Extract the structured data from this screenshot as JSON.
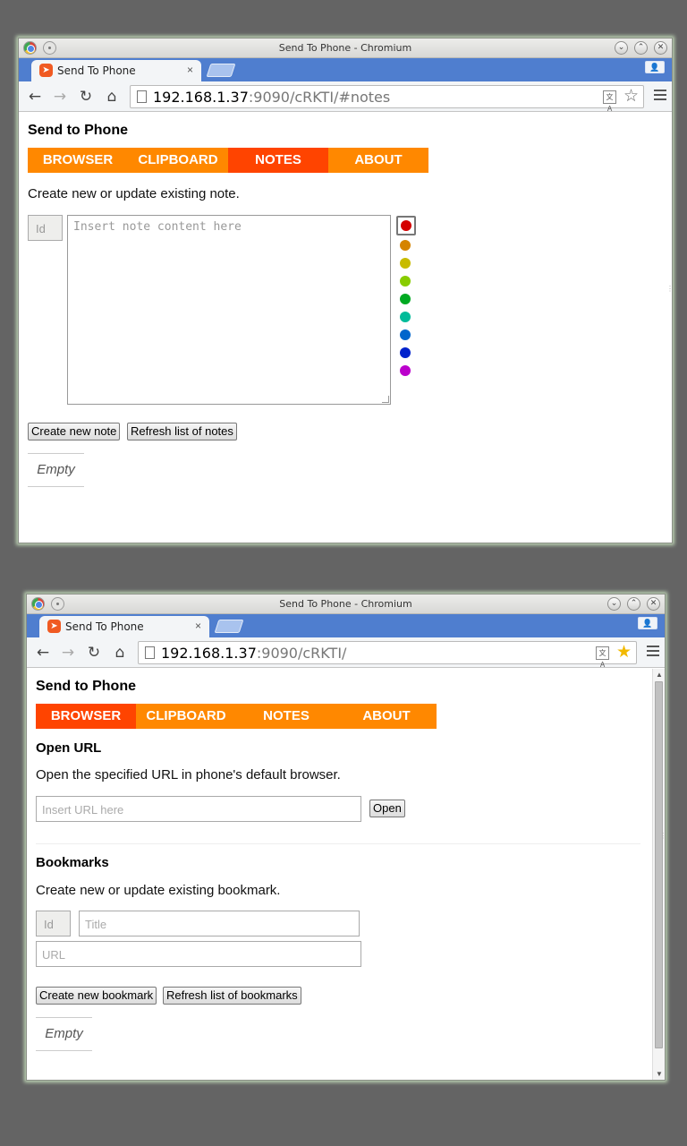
{
  "window1": {
    "title": "Send To Phone - Chromium",
    "tab_label": "Send To Phone",
    "tab_close": "×",
    "url_host": "192.168.1.37",
    "url_rest": ":9090/cRKTI/#notes",
    "app_title": "Send to Phone",
    "nav": [
      "BROWSER",
      "CLIPBOARD",
      "NOTES",
      "ABOUT"
    ],
    "active_nav": "NOTES",
    "intro": "Create new or update existing note.",
    "id_placeholder": "Id",
    "note_placeholder": "Insert note content here",
    "colors": [
      "#d40000",
      "#d58400",
      "#c8bb00",
      "#88cc00",
      "#00aa22",
      "#00bb99",
      "#0066cc",
      "#0022cc",
      "#bb00cc"
    ],
    "selected_color": "#d40000",
    "create_button": "Create new note",
    "refresh_button": "Refresh list of notes",
    "empty_label": "Empty"
  },
  "window2": {
    "title": "Send To Phone - Chromium",
    "tab_label": "Send To Phone",
    "tab_close": "×",
    "url_host": "192.168.1.37",
    "url_rest": ":9090/cRKTI/",
    "app_title": "Send to Phone",
    "nav": [
      "BROWSER",
      "CLIPBOARD",
      "NOTES",
      "ABOUT"
    ],
    "active_nav": "BROWSER",
    "open_url_heading": "Open URL",
    "open_url_desc": "Open the specified URL in phone's default browser.",
    "url_placeholder": "Insert URL here",
    "open_button": "Open",
    "bookmarks_heading": "Bookmarks",
    "bookmarks_desc": "Create new or update existing bookmark.",
    "id_placeholder": "Id",
    "title_placeholder": "Title",
    "bm_url_placeholder": "URL",
    "create_button": "Create new bookmark",
    "refresh_button": "Refresh list of bookmarks",
    "empty_label": "Empty"
  },
  "icons": {
    "back": "back-arrow-icon",
    "forward": "forward-arrow-icon",
    "reload": "reload-icon",
    "home": "home-icon",
    "star": "bookmark-star-icon",
    "menu": "hamburger-menu-icon"
  }
}
